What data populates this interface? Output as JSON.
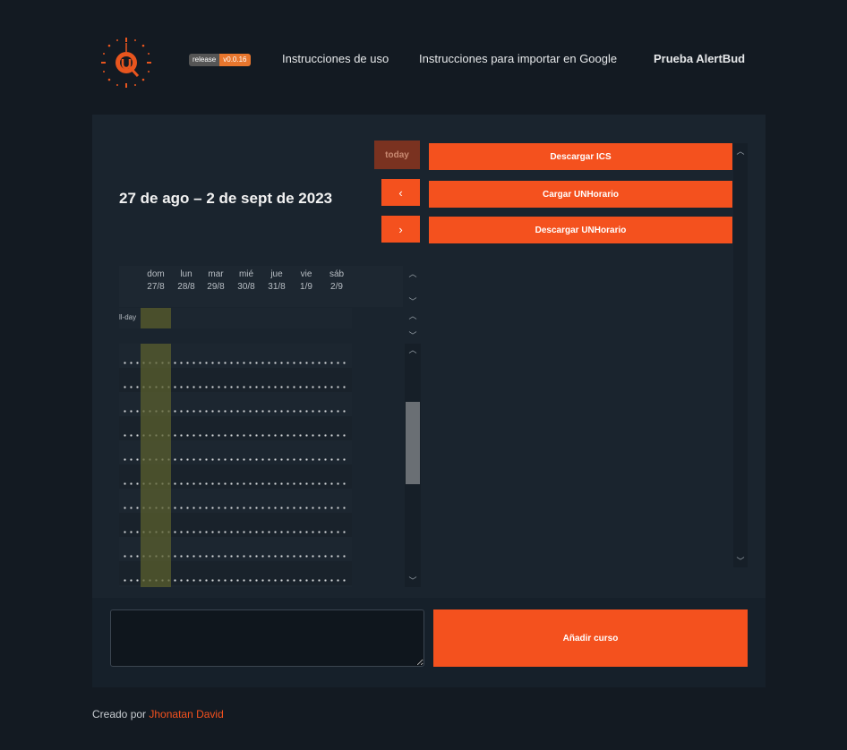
{
  "header": {
    "badge_left": "release",
    "badge_right": "v0.0.16",
    "nav": [
      "Instrucciones de uso",
      "Instrucciones para importar en Google",
      "Prueba AlertBud"
    ]
  },
  "calendar": {
    "title": "27 de ago – 2 de sept de 2023",
    "today_label": "today",
    "prev_label": "‹",
    "next_label": "›",
    "allday_label": "ll-day",
    "days": [
      {
        "name": "dom",
        "date": "27/8"
      },
      {
        "name": "lun",
        "date": "28/8"
      },
      {
        "name": "mar",
        "date": "29/8"
      },
      {
        "name": "mié",
        "date": "30/8"
      },
      {
        "name": "jue",
        "date": "31/8"
      },
      {
        "name": "vie",
        "date": "1/9"
      },
      {
        "name": "sáb",
        "date": "2/9"
      }
    ]
  },
  "actions": {
    "download_ics": "Descargar ICS",
    "load_unhorario": "Cargar UNHorario",
    "download_unhorario": "Descargar UNHorario"
  },
  "course": {
    "input_value": "",
    "add_label": "Añadir curso"
  },
  "footer": {
    "prefix": "Creado por ",
    "author": "Jhonatan David"
  },
  "colors": {
    "accent": "#f4511e",
    "background": "#131a22",
    "panel": "#1a242e",
    "today_highlight": "#4a4f2c"
  },
  "icons": [
    "logo-clock-icon",
    "chevron-left-icon",
    "chevron-right-icon",
    "scroll-up-icon",
    "scroll-down-icon"
  ]
}
